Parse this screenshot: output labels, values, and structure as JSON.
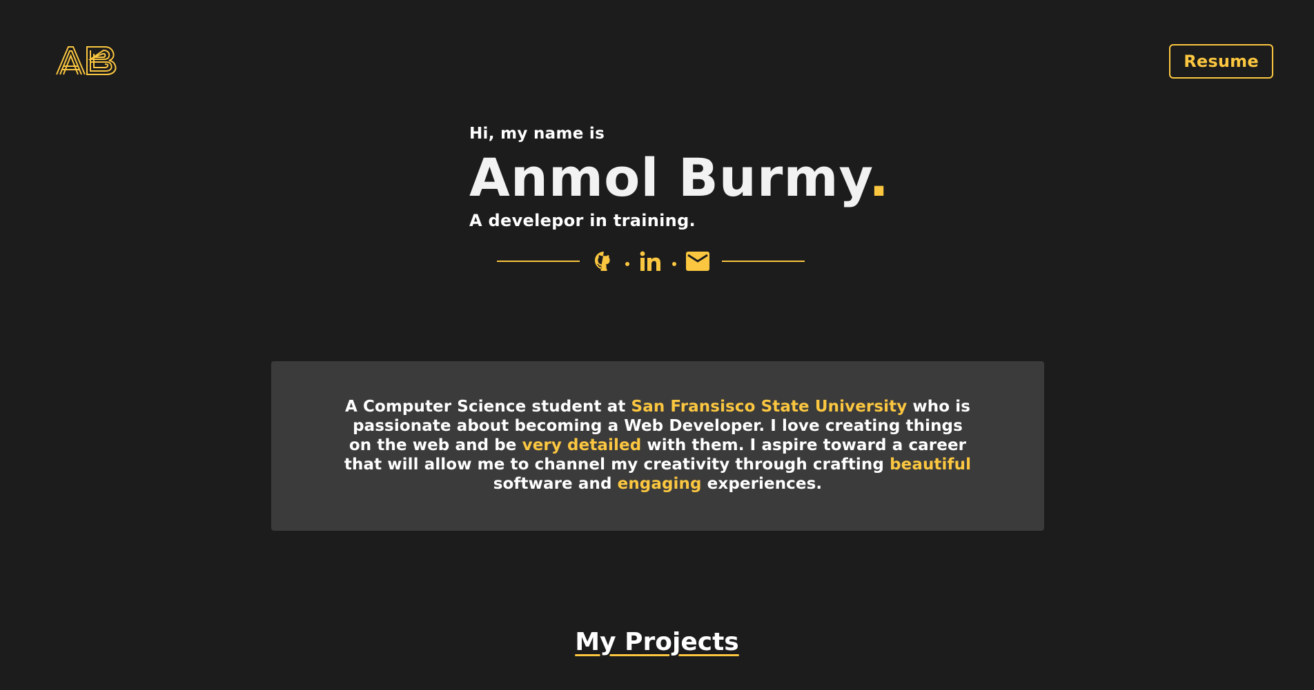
{
  "header": {
    "logo_text": "AB",
    "logo_icon": "ab-monogram-logo",
    "resume_label": "Resume"
  },
  "hero": {
    "greeting": "Hi, my name is",
    "name": "Anmol Burmy",
    "name_suffix": ".",
    "tagline": "A develepor in training."
  },
  "social": {
    "icons": [
      "github-icon",
      "linkedin-icon",
      "mail-icon"
    ]
  },
  "about": {
    "parts": [
      {
        "text": "A Computer Science student at ",
        "highlight": false
      },
      {
        "text": "San Fransisco State University",
        "highlight": true
      },
      {
        "text": " who is passionate about becoming a Web Developer. I love creating things on the web and be ",
        "highlight": false
      },
      {
        "text": "very detailed",
        "highlight": true
      },
      {
        "text": " with them. I aspire toward a career that will allow me to channel my creativity through crafting ",
        "highlight": false
      },
      {
        "text": "beautiful",
        "highlight": true
      },
      {
        "text": " software and ",
        "highlight": false
      },
      {
        "text": "engaging",
        "highlight": true
      },
      {
        "text": " experiences.",
        "highlight": false
      }
    ]
  },
  "projects": {
    "title": "My Projects"
  },
  "colors": {
    "background": "#1c1c1c",
    "accent": "#fcc740",
    "card": "#3b3b3b",
    "text": "#ffffff"
  }
}
